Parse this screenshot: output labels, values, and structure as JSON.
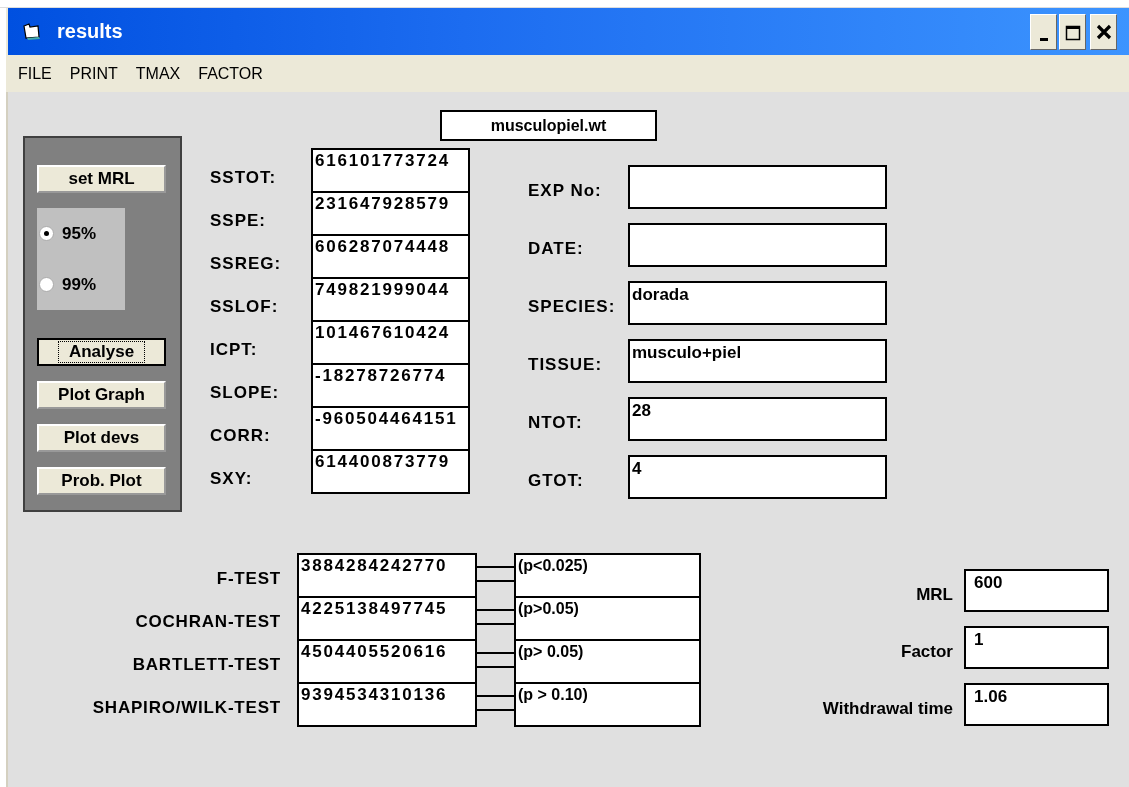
{
  "window": {
    "title": "results"
  },
  "menu": [
    "FILE",
    "PRINT",
    "TMAX",
    "FACTOR"
  ],
  "file_name": "musculopiel.wt",
  "panel": {
    "set_button": {
      "label": "set MRL",
      "focused": false
    },
    "confidence": [
      {
        "label": "95%",
        "selected": true
      },
      {
        "label": "99%",
        "selected": false
      }
    ],
    "buttons": [
      {
        "label": "Analyse",
        "focused": true
      },
      {
        "label": "Plot Graph",
        "focused": false
      },
      {
        "label": "Plot devs",
        "focused": false
      },
      {
        "label": "Prob. Plot",
        "focused": false
      }
    ]
  },
  "statistics": [
    {
      "label": "SSTOT:",
      "value": "616101773724"
    },
    {
      "label": "SSPE:",
      "value": "231647928579"
    },
    {
      "label": "SSREG:",
      "value": "606287074448"
    },
    {
      "label": "SSLOF:",
      "value": "749821999044"
    },
    {
      "label": "ICPT:",
      "value": "101467610424"
    },
    {
      "label": "SLOPE:",
      "value": "-18278726774"
    },
    {
      "label": "CORR:",
      "value": "-960504464151"
    },
    {
      "label": "SXY:",
      "value": "614400873779"
    }
  ],
  "sample_info": [
    {
      "label": "EXP No:"
    },
    {
      "label": "DATE:"
    },
    {
      "label": "SPECIES:",
      "value": "dorada"
    },
    {
      "label": "TISSUE:",
      "value": "musculo+piel"
    },
    {
      "label": "NTOT:",
      "value": "28"
    },
    {
      "label": "GTOT:",
      "value": "4"
    }
  ],
  "tests": [
    {
      "label": "F-TEST",
      "value": "3884284242770",
      "result": "(p<0.025)"
    },
    {
      "label": "COCHRAN-TEST",
      "value": "4225138497745",
      "result": "(p>0.05)"
    },
    {
      "label": "BARTLETT-TEST",
      "value": "4504405520616",
      "result": "(p> 0.05)"
    },
    {
      "label": "SHAPIRO/WILK-TEST",
      "value": "9394534310136",
      "result": "(p > 0.10)"
    }
  ],
  "outputs": [
    {
      "label": "MRL",
      "value": "600"
    },
    {
      "label": "Factor",
      "value": "1"
    },
    {
      "label": "Withdrawal time",
      "value": "1.06"
    }
  ]
}
